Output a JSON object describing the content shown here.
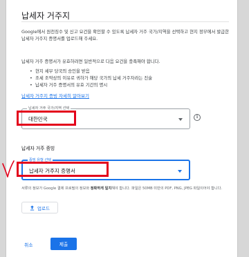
{
  "dialog": {
    "title": "납세자 거주지",
    "intro": "Google에서 원천징수 및 신고 요건을 확인할 수 있도록 납세자 거주 국가/지역을 선택하고 현지 정부에서 발급한 납세자 거주지 증명서를 업로드해 주세요.",
    "requirements_intro": "납세자 거주 증명서가 유효하려면 일반적으로 다음 요건을 충족해야 합니다.",
    "requirements": [
      "현지 세무 당국의 승인을 받음",
      "조세 조약상의 이유로 귀하가 해당 국가의 납세 거주자라는 진술",
      "납세자 거주 증명서의 유효 기간의 명시"
    ],
    "more_link": "납세자 거주지 증빙 자세히 알아보기"
  },
  "residence_field": {
    "label": "납세자 거주 국가/지역 선택",
    "value": "대한민국"
  },
  "proof_section": {
    "label": "납세자 거주 증빙"
  },
  "proof_type_field": {
    "label": "증빙 유형 선택",
    "value": "납세자 거주지 증명서"
  },
  "help": {
    "before_bold": "서류의 정보가 Google 결제 프로필의 정보와 ",
    "bold": "정확하게 일치",
    "after_bold": "해야 합니다. 파일은 50MB 미만의 PDF, PNG, JPEG 파일이어야 합니다."
  },
  "buttons": {
    "upload": "업로드",
    "cancel": "취소",
    "submit": "제출"
  },
  "icons": {
    "info": "info-icon",
    "upload": "upload-icon",
    "dropdown": "chevron-down-icon"
  },
  "colors": {
    "accent": "#1a73e8",
    "annotation_red": "#e3001b"
  }
}
